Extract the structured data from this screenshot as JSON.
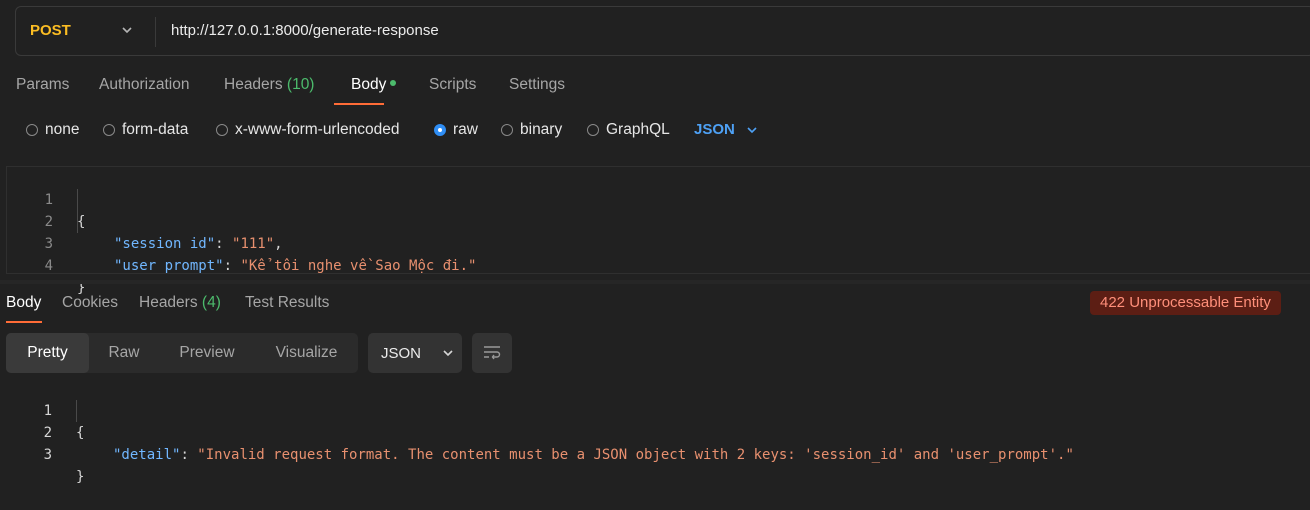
{
  "request": {
    "method": "POST",
    "url": "http://127.0.0.1:8000/generate-response"
  },
  "request_tabs": [
    {
      "label": "Params"
    },
    {
      "label": "Authorization"
    },
    {
      "label": "Headers",
      "count": "(10)"
    },
    {
      "label": "Body",
      "active": true
    },
    {
      "label": "Scripts"
    },
    {
      "label": "Settings"
    }
  ],
  "body_types": {
    "options": [
      "none",
      "form-data",
      "x-www-form-urlencoded",
      "raw",
      "binary",
      "GraphQL"
    ],
    "selected": "raw",
    "format": "JSON"
  },
  "request_body_lines": [
    {
      "n": "1",
      "text": "{"
    },
    {
      "n": "2",
      "key": "\"session id\"",
      "sep": ": ",
      "value": "\"111\"",
      "end": ","
    },
    {
      "n": "3",
      "key": "\"user prompt\"",
      "sep": ": ",
      "value": "\"Kể tôi nghe về Sao Mộc đi.\"",
      "end": ""
    },
    {
      "n": "4",
      "text": "}"
    }
  ],
  "response_tabs": [
    {
      "label": "Body",
      "active": true
    },
    {
      "label": "Cookies"
    },
    {
      "label": "Headers",
      "count": "(4)"
    },
    {
      "label": "Test Results"
    }
  ],
  "status": "422 Unprocessable Entity",
  "view_modes": [
    "Pretty",
    "Raw",
    "Preview",
    "Visualize"
  ],
  "active_view": "Pretty",
  "response_format": "JSON",
  "response_body_lines": [
    {
      "n": "1",
      "text": "{"
    },
    {
      "n": "2",
      "key": "\"detail\"",
      "sep": ": ",
      "value": "\"Invalid request format. The content must be a JSON object with 2 keys: 'session_id' and 'user_prompt'.\"",
      "end": ""
    },
    {
      "n": "3",
      "text": "}"
    }
  ],
  "colors": {
    "method": "#fbbd23",
    "accent": "#ff6c37",
    "count": "#4cbb6c",
    "radio_checked": "#2f8ef5",
    "json_key": "#71b7ff",
    "json_string": "#e8906f",
    "error_badge_bg": "#5c1e14",
    "error_badge_text": "#ff8f7a"
  },
  "icons": [
    "chevron-down-icon",
    "wrap-lines-icon"
  ]
}
